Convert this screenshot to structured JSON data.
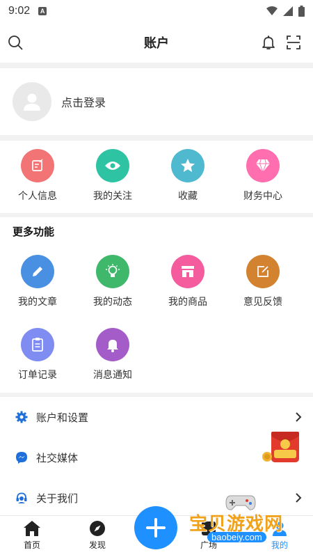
{
  "status_bar": {
    "time": "9:02",
    "app_badge": "A"
  },
  "header": {
    "title": "账户"
  },
  "login": {
    "label": "点击登录"
  },
  "quick_actions": [
    {
      "label": "个人信息",
      "icon": "note-icon",
      "color": "#f27474"
    },
    {
      "label": "我的关注",
      "icon": "eye-icon",
      "color": "#2ec4a3"
    },
    {
      "label": "收藏",
      "icon": "star-icon",
      "color": "#4fb9cf"
    },
    {
      "label": "财务中心",
      "icon": "diamond-icon",
      "color": "#ff6fb0"
    }
  ],
  "more_functions": {
    "title": "更多功能",
    "items": [
      {
        "label": "我的文章",
        "icon": "pencil-icon",
        "color": "#4a90e2"
      },
      {
        "label": "我的动态",
        "icon": "lightbulb-icon",
        "color": "#3fb86b"
      },
      {
        "label": "我的商品",
        "icon": "store-icon",
        "color": "#f45c9e"
      },
      {
        "label": "意见反馈",
        "icon": "edit-icon",
        "color": "#d3822f"
      },
      {
        "label": "订单记录",
        "icon": "clipboard-icon",
        "color": "#7f8cf2"
      },
      {
        "label": "消息通知",
        "icon": "bell-icon",
        "color": "#a45cc9"
      }
    ]
  },
  "settings_list": [
    {
      "label": "账户和设置",
      "icon": "gear-icon"
    },
    {
      "label": "社交媒体",
      "icon": "messenger-icon"
    },
    {
      "label": "关于我们",
      "icon": "headset-icon"
    }
  ],
  "tabbar": {
    "tabs": [
      {
        "label": "首页",
        "icon": "home-icon"
      },
      {
        "label": "发现",
        "icon": "compass-icon"
      },
      {
        "label": "广场",
        "icon": "square-icon"
      },
      {
        "label": "我的",
        "icon": "user-icon"
      }
    ]
  },
  "watermark": {
    "text": "宝贝游戏网",
    "url": "baobeiy.com"
  },
  "colors": {
    "accent": "#1e90ff",
    "background": "#f2f2f2"
  }
}
